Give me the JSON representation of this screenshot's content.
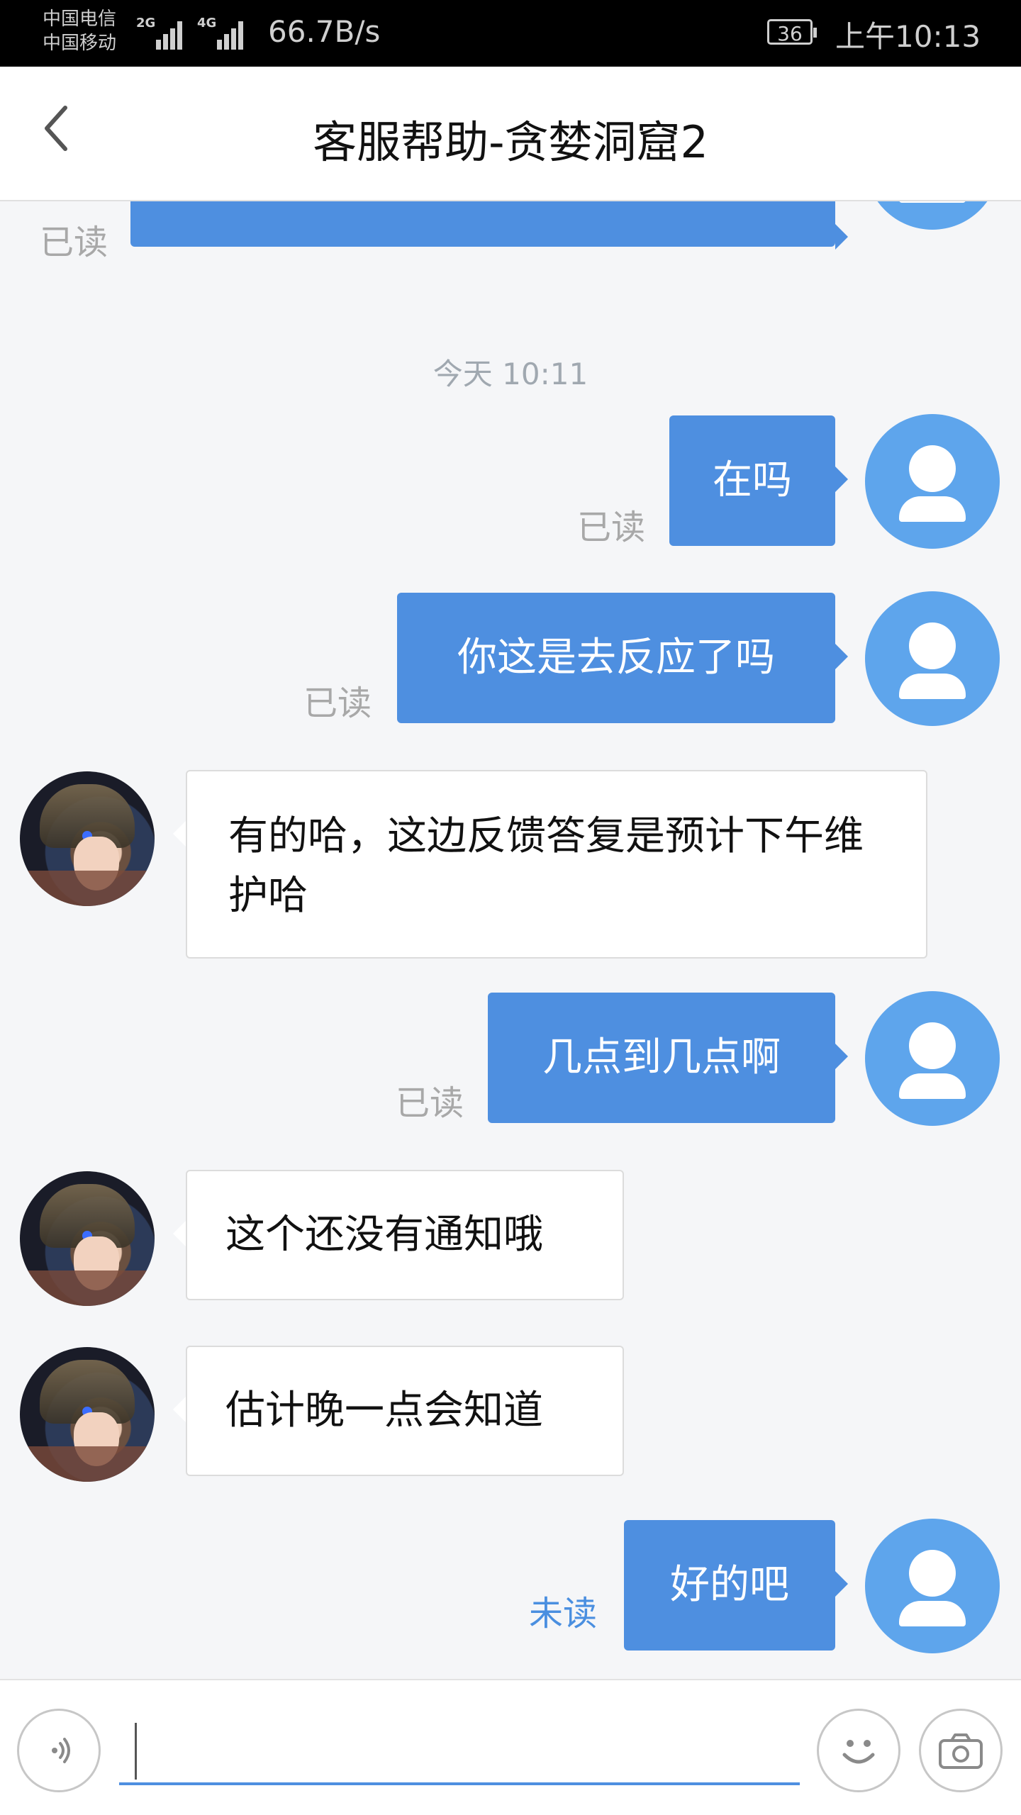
{
  "status_bar": {
    "carrier1": "中国电信",
    "carrier2": "中国移动",
    "signal1_type": "2G",
    "signal2_type": "4G",
    "net_speed": "66.7B/s",
    "battery": "36",
    "time": "上午10:13"
  },
  "header": {
    "back_icon": "chevron-left-icon",
    "title": "客服帮助-贪婪洞窟2"
  },
  "chat": {
    "timestamp": "今天 10:11",
    "read_label": "已读",
    "unread_label": "未读",
    "messages": [
      {
        "from": "user",
        "text": "",
        "status": "已读"
      },
      {
        "from": "user",
        "text": "在吗",
        "status": "已读"
      },
      {
        "from": "user",
        "text": "你这是去反应了吗",
        "status": "已读"
      },
      {
        "from": "agent",
        "text": "有的哈，这边反馈答复是预计下午维护哈"
      },
      {
        "from": "user",
        "text": "几点到几点啊",
        "status": "已读"
      },
      {
        "from": "agent",
        "text": "这个还没有通知哦"
      },
      {
        "from": "agent",
        "text": "估计晚一点会知道"
      },
      {
        "from": "user",
        "text": "好的吧",
        "status": "未读"
      }
    ]
  },
  "input_bar": {
    "voice_icon": "voice-icon",
    "emoji_icon": "smiley-icon",
    "camera_icon": "camera-icon",
    "input_value": ""
  },
  "colors": {
    "user_bubble": "#4e8fe0",
    "user_avatar": "#5ea5ec",
    "unread": "#4a8fe0"
  }
}
